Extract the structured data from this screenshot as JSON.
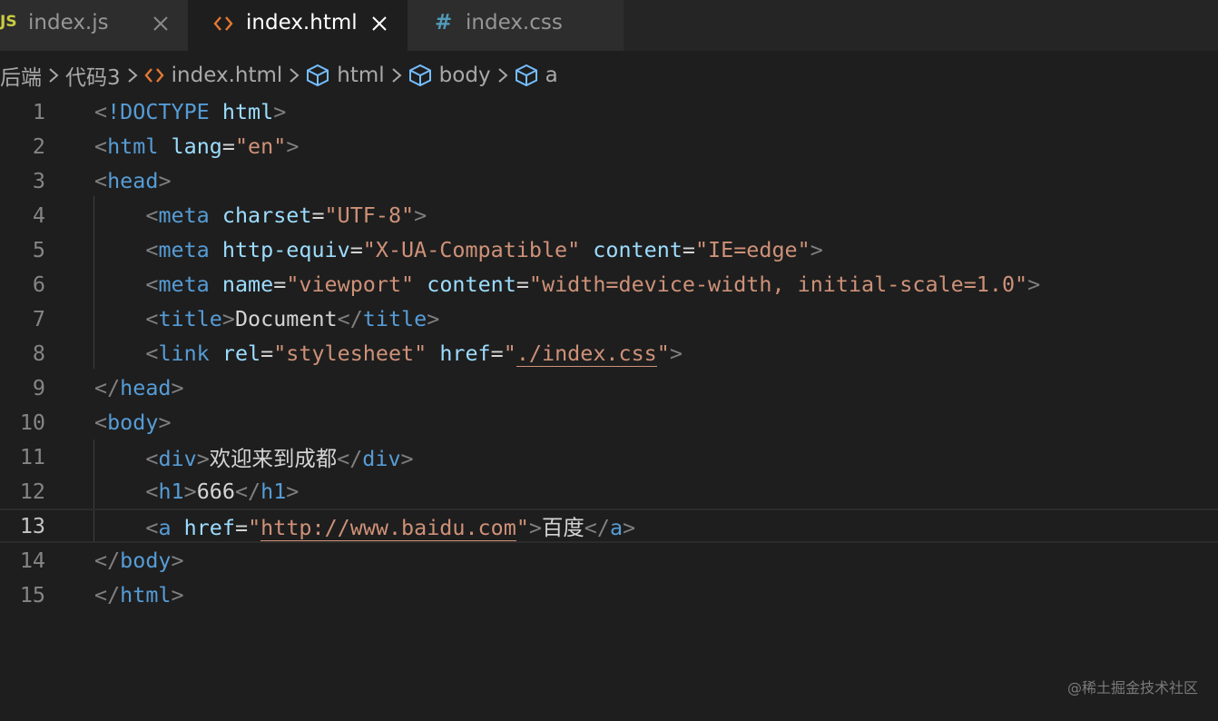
{
  "tabs": [
    {
      "icon": "JS",
      "label": "index.js"
    },
    {
      "icon": "<>",
      "label": "index.html"
    },
    {
      "icon": "#",
      "label": "index.css"
    }
  ],
  "breadcrumb": [
    "后端",
    "代码3",
    "index.html",
    "html",
    "body",
    "a"
  ],
  "lines": [
    {
      "num": "1"
    },
    {
      "num": "2"
    },
    {
      "num": "3"
    },
    {
      "num": "4"
    },
    {
      "num": "5"
    },
    {
      "num": "6"
    },
    {
      "num": "7"
    },
    {
      "num": "8"
    },
    {
      "num": "9"
    },
    {
      "num": "10"
    },
    {
      "num": "11"
    },
    {
      "num": "12"
    },
    {
      "num": "13"
    },
    {
      "num": "14"
    },
    {
      "num": "15"
    }
  ],
  "code": {
    "l1": {
      "doctype": "!DOCTYPE",
      "html": "html"
    },
    "l2": {
      "tag": "html",
      "attr": "lang",
      "val": "\"en\""
    },
    "l3": {
      "tag": "head"
    },
    "l4": {
      "tag": "meta",
      "attr": "charset",
      "val": "\"UTF-8\""
    },
    "l5": {
      "tag": "meta",
      "attr1": "http-equiv",
      "val1": "\"X-UA-Compatible\"",
      "attr2": "content",
      "val2": "\"IE=edge\""
    },
    "l6": {
      "tag": "meta",
      "attr1": "name",
      "val1": "\"viewport\"",
      "attr2": "content",
      "val2": "\"width=device-width, initial-scale=1.0\""
    },
    "l7": {
      "tag": "title",
      "text": "Document"
    },
    "l8": {
      "tag": "link",
      "attr1": "rel",
      "val1": "\"stylesheet\"",
      "attr2": "href",
      "q": "\"",
      "path": "./index.css"
    },
    "l9": {
      "tag": "head"
    },
    "l10": {
      "tag": "body"
    },
    "l11": {
      "tag": "div",
      "text": "欢迎来到成都"
    },
    "l12": {
      "tag": "h1",
      "text": "666"
    },
    "l13": {
      "tag": "a",
      "attr": "href",
      "q": "\"",
      "url": "http://www.baidu.com",
      "text": "百度"
    },
    "l14": {
      "tag": "body"
    },
    "l15": {
      "tag": "html"
    }
  },
  "watermark": "@稀土掘金技术社区",
  "colors": {
    "tag": "#569cd6",
    "attr": "#9cdcfe",
    "string": "#ce9178",
    "punct": "#808080",
    "text": "#d4d4d4",
    "background": "#1e1e1e"
  }
}
